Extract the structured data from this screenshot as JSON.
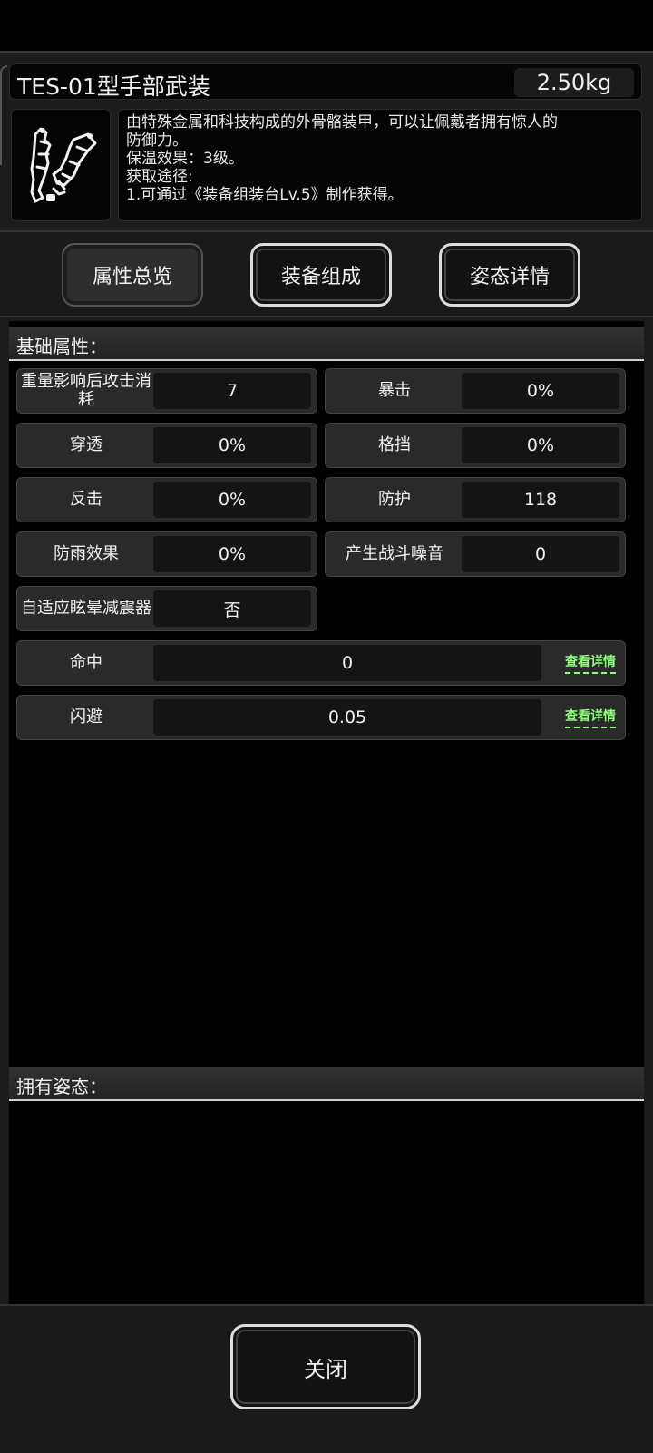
{
  "item": {
    "name": "TES-01型手部武装",
    "weight": "2.50kg",
    "description": [
      "由特殊金属和科技构成的外骨骼装甲，可以让佩戴者拥有惊人的",
      "防御力。",
      "保温效果：3级。",
      "获取途径:",
      "1.可通过《装备组装台Lv.5》制作获得。"
    ]
  },
  "tabs": {
    "overview": "属性总览",
    "composition": "装备组成",
    "stance": "姿态详情"
  },
  "basic": {
    "header": "基础属性：",
    "stats": [
      {
        "label": "重量影响后攻击消耗",
        "value": "7"
      },
      {
        "label": "暴击",
        "value": "0%"
      },
      {
        "label": "穿透",
        "value": "0%"
      },
      {
        "label": "格挡",
        "value": "0%"
      },
      {
        "label": "反击",
        "value": "0%"
      },
      {
        "label": "防护",
        "value": "118"
      },
      {
        "label": "防雨效果",
        "value": "0%"
      },
      {
        "label": "产生战斗噪音",
        "value": "0"
      },
      {
        "label": "自适应眩晕减震器",
        "value": "否"
      }
    ],
    "wide_stats": [
      {
        "label": "命中",
        "value": "0",
        "link": "查看详情"
      },
      {
        "label": "闪避",
        "value": "0.05",
        "link": "查看详情"
      }
    ]
  },
  "stance_section": {
    "header": "拥有姿态："
  },
  "footer": {
    "close_label": "关闭"
  },
  "icons": {
    "item": "exoskeleton-arm-icon"
  }
}
